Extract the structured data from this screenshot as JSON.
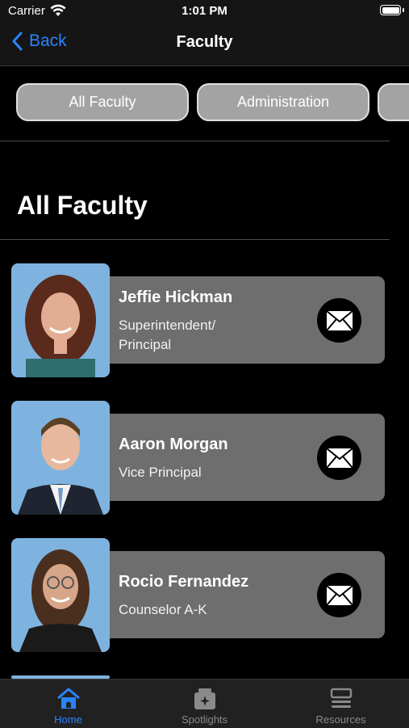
{
  "status_bar": {
    "carrier": "Carrier",
    "time": "1:01 PM"
  },
  "nav": {
    "back_label": "Back",
    "title": "Faculty"
  },
  "filters": [
    {
      "label": "All Faculty"
    },
    {
      "label": "Administration"
    },
    {
      "label": ""
    }
  ],
  "section_title": "All Faculty",
  "faculty": [
    {
      "name": "Jeffie Hickman",
      "role": "Superintendent/\nPrincipal"
    },
    {
      "name": "Aaron Morgan",
      "role": "Vice Principal"
    },
    {
      "name": "Rocio Fernandez",
      "role": "Counselor A-K"
    }
  ],
  "tabs": [
    {
      "label": "Home",
      "icon": "home-icon",
      "active": true
    },
    {
      "label": "Spotlights",
      "icon": "spotlights-icon",
      "active": false
    },
    {
      "label": "Resources",
      "icon": "resources-icon",
      "active": false
    }
  ],
  "colors": {
    "accent": "#2a84ff",
    "card": "#6e6e6e",
    "chip": "#a3a3a3",
    "background": "#000000"
  }
}
